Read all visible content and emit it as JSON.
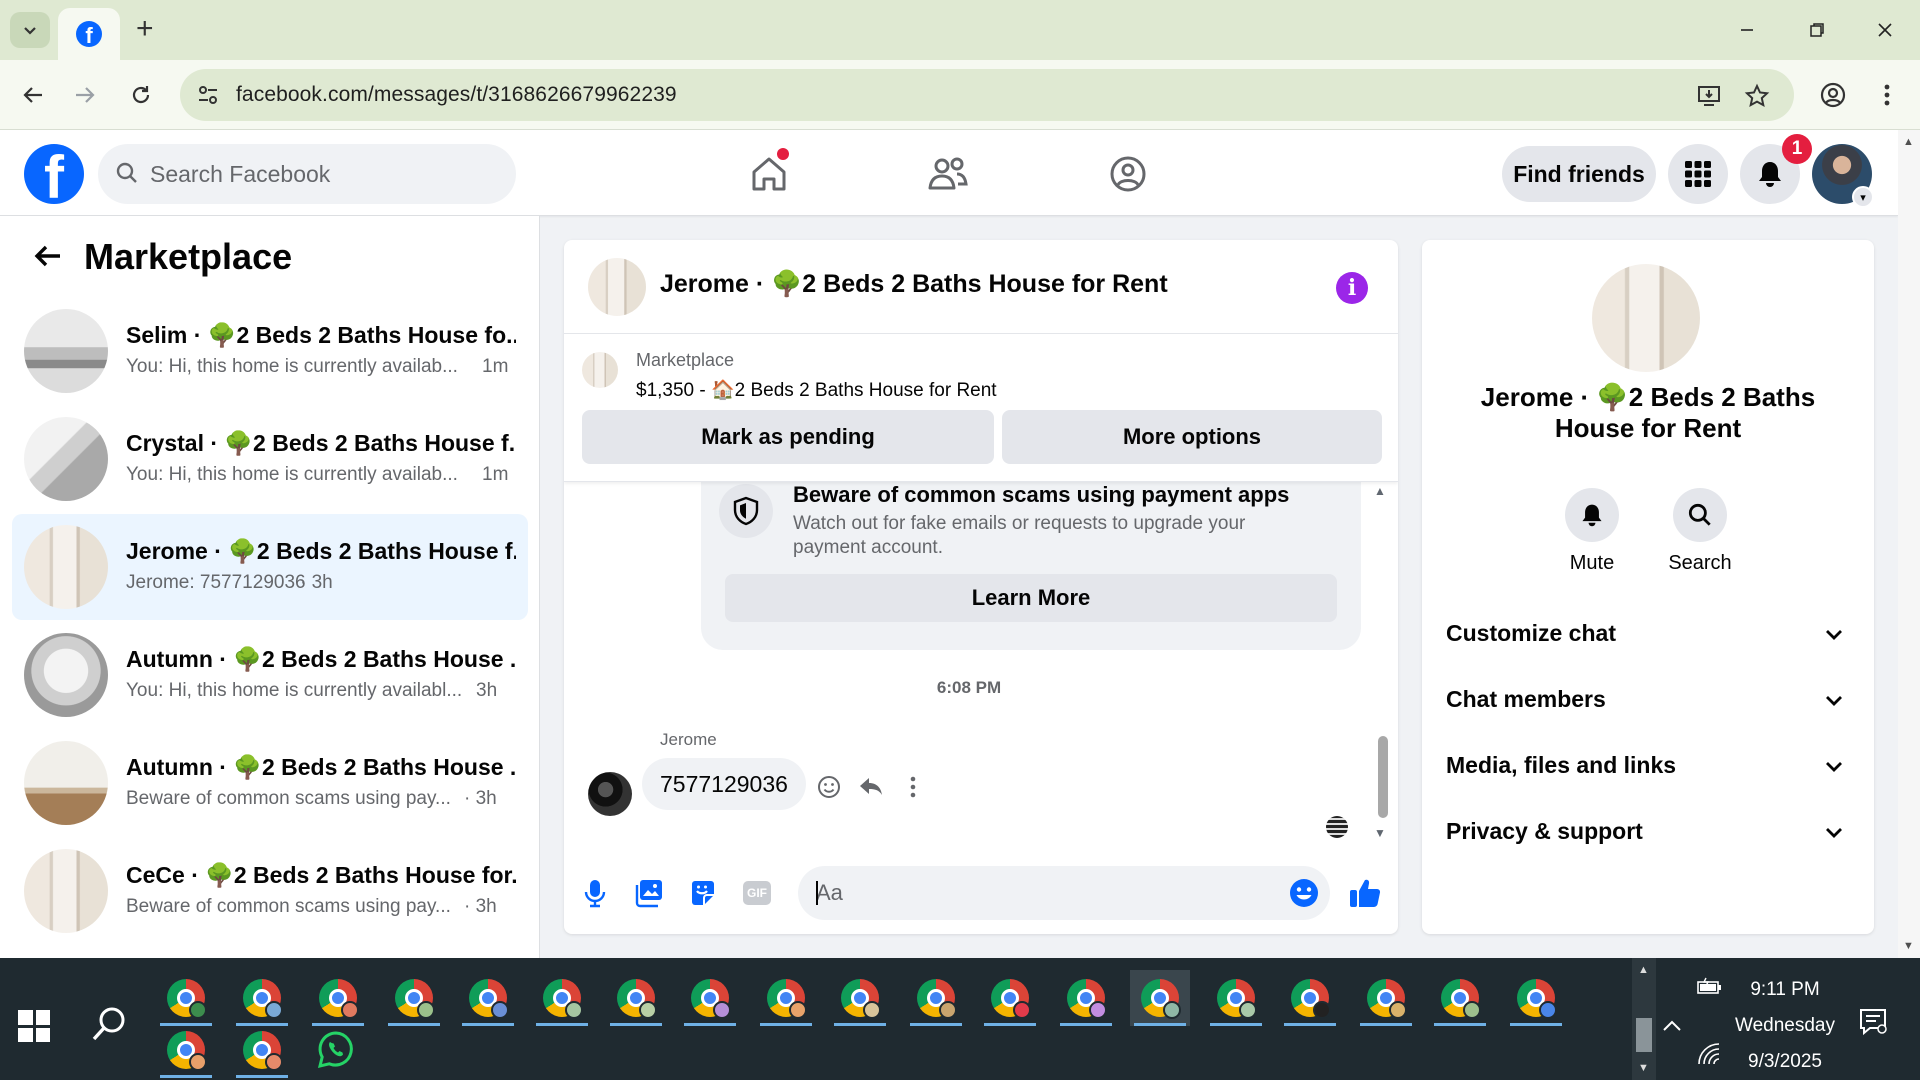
{
  "browser": {
    "url": "facebook.com/messages/t/3168626679962239"
  },
  "header": {
    "search_placeholder": "Search Facebook",
    "find_friends_label": "Find friends",
    "notification_count": "1"
  },
  "sidebar": {
    "title": "Marketplace",
    "conversations": [
      {
        "name": "Selim · 🌳2 Beds 2 Baths House fo...",
        "snippet": "You: Hi, this home is currently availab...",
        "time": "1m",
        "selected": false
      },
      {
        "name": "Crystal · 🌳2 Beds 2 Baths House f...",
        "snippet": "You: Hi, this home is currently availab...",
        "time": "1m",
        "selected": false
      },
      {
        "name": "Jerome · 🌳2 Beds 2 Baths House f...",
        "snippet": "Jerome: 7577129036",
        "time": "· 3h",
        "selected": true
      },
      {
        "name": "Autumn · 🌳2 Beds 2 Baths House ...",
        "snippet": "You: Hi, this home is currently availabl...",
        "time": "3h",
        "selected": false
      },
      {
        "name": "Autumn · 🌳2 Beds 2 Baths House ...",
        "snippet": "Beware of common scams using pay...",
        "time": "· 3h",
        "selected": false
      },
      {
        "name": "CeCe · 🌳2 Beds 2 Baths House for...",
        "snippet": "Beware of common scams using pay...",
        "time": "· 3h",
        "selected": false
      }
    ]
  },
  "chat": {
    "title": "Jerome · 🌳2 Beds 2 Baths House for Rent",
    "listing": {
      "source": "Marketplace",
      "price_line": "$1,350 - 🏠2 Beds 2 Baths House for Rent",
      "mark_pending_label": "Mark as pending",
      "more_options_label": "More options"
    },
    "scam_notice": {
      "title": "Beware of common scams using payment apps",
      "body": "Watch out for fake emails or requests to upgrade your payment account.",
      "button_label": "Learn More"
    },
    "timestamp": "6:08 PM",
    "last_message": {
      "sender": "Jerome",
      "text": "7577129036"
    },
    "composer_placeholder": "Aa"
  },
  "info_panel": {
    "name": "Jerome · 🌳2 Beds 2 Baths House for Rent",
    "mute_label": "Mute",
    "search_label": "Search",
    "sections": [
      "Customize chat",
      "Chat members",
      "Media, files and links",
      "Privacy & support"
    ]
  },
  "taskbar": {
    "time": "9:11 PM",
    "day": "Wednesday",
    "date": "9/3/2025"
  },
  "colors": {
    "fb_blue": "#0866ff",
    "selected_row": "#ebf5ff",
    "info_purple": "#9b26e8",
    "badge_red": "#e41e3f"
  }
}
